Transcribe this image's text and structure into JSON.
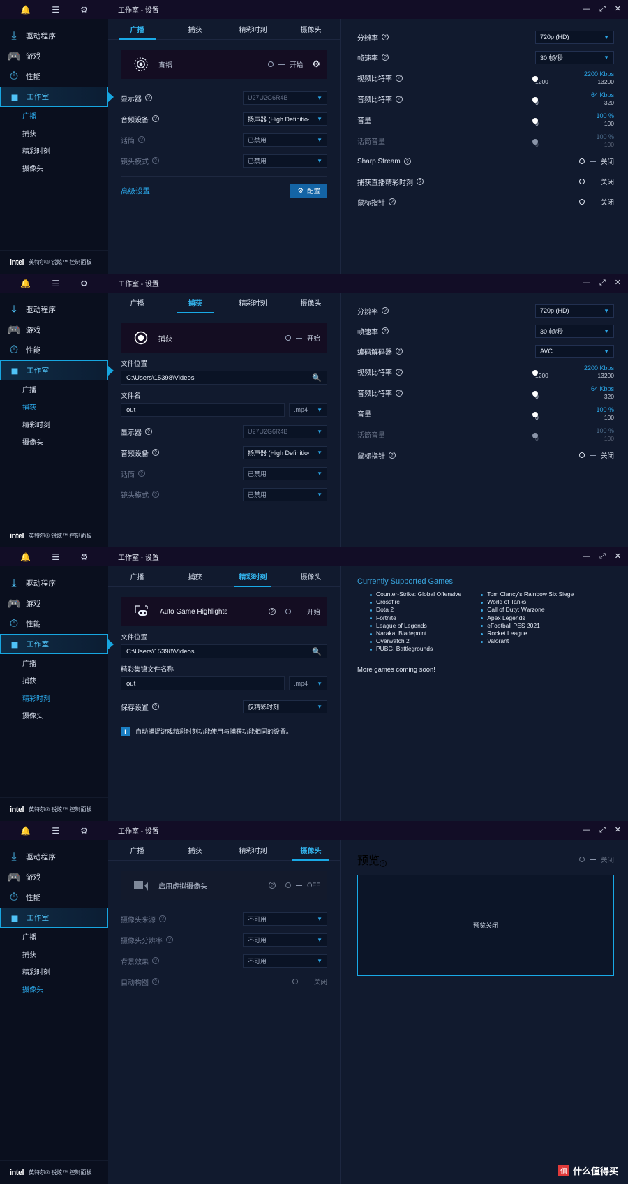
{
  "app": {
    "brand_logo": "intel",
    "brand_text": "英特尔® 锐炫™ 控制面板",
    "window_title": "工作室 - 设置",
    "min_label": "—",
    "max_label": "⤢",
    "close_label": "✕",
    "bell_icon": "bell-icon",
    "menu_icon": "menu-icon",
    "gear_icon": "gear-icon"
  },
  "sidebar": {
    "items": [
      {
        "label": "驱动程序",
        "icon": "download-icon"
      },
      {
        "label": "游戏",
        "icon": "gamepad-icon"
      },
      {
        "label": "性能",
        "icon": "gauge-icon"
      },
      {
        "label": "工作室",
        "icon": "camcorder-icon"
      }
    ],
    "sub_items": [
      {
        "label": "广播"
      },
      {
        "label": "捕获"
      },
      {
        "label": "精彩时刻"
      },
      {
        "label": "摄像头"
      }
    ]
  },
  "tabs": [
    {
      "label": "广播"
    },
    {
      "label": "捕获"
    },
    {
      "label": "精彩时刻"
    },
    {
      "label": "摄像头"
    }
  ],
  "common": {
    "start_label": "开始",
    "off_label": "关闭",
    "off_en_label": "OFF",
    "file_location_label": "文件位置",
    "file_location_value": "C:\\Users\\15398\\Videos",
    "search_icon": "search-icon",
    "filename_value": "out",
    "ext_value": ".mp4",
    "resolution_label": "分辨率",
    "resolution_value": "720p (HD)",
    "framerate_label": "帧速率",
    "framerate_value": "30 帧/秒",
    "video_bitrate_label": "视频比特率",
    "video_bitrate_value": "2200 Kbps",
    "video_bitrate_min": "1200",
    "video_bitrate_max": "13200",
    "audio_bitrate_label": "音频比特率",
    "audio_bitrate_value": "64 Kbps",
    "audio_bitrate_min": "0",
    "audio_bitrate_max": "320",
    "volume_label": "音量",
    "volume_value": "100 %",
    "volume_min": "0",
    "volume_max": "100",
    "mic_volume_label": "话筒音量",
    "mic_volume_value": "100 %",
    "mic_volume_min": "0",
    "mic_volume_max": "100",
    "mouse_pointer_label": "鼠标指针",
    "display_label": "显示器",
    "display_value": "U27U2G6R4B",
    "audio_device_label": "音频设备",
    "audio_device_value": "扬声器 (High Definitio⋯",
    "mic_label": "话筒",
    "mic_value": "已禁用",
    "lens_mode_label": "镜头模式",
    "lens_mode_value": "已禁用"
  },
  "panel_broadcast": {
    "hero_title": "直播",
    "hero_icon": "broadcast-icon",
    "gear_icon": "gear-icon",
    "advanced_label": "高级设置",
    "configure_label": "配置",
    "sharp_stream_label": "Sharp Stream",
    "capture_highlights_label": "捕获直播精彩时刻"
  },
  "panel_capture": {
    "hero_title": "捕获",
    "hero_icon": "record-icon",
    "filename_label": "文件名",
    "codec_label": "编码解码器",
    "codec_value": "AVC"
  },
  "panel_highlights": {
    "hero_title": "Auto Game Highlights",
    "hero_icon": "game-highlights-icon",
    "filename_label": "精彩集锦文件名称",
    "save_settings_label": "保存设置",
    "save_settings_value": "仅精彩时刻",
    "info_icon": "info-icon",
    "info_text": "自动捕捉游戏精彩时刻功能使用与捕获功能相同的设置。",
    "games_heading": "Currently Supported Games",
    "games_col1": [
      "Counter-Strike: Global Offensive",
      "Crossfire",
      "Dota 2",
      "Fortnite",
      "League of Legends",
      "Naraka: Bladepoint",
      "Overwatch 2",
      "PUBG: Battlegrounds"
    ],
    "games_col2": [
      "Tom Clancy's Rainbow Six Siege",
      "World of Tanks",
      "Call of Duty: Warzone",
      "Apex Legends",
      "eFootball PES 2021",
      "Rocket League",
      "Valorant"
    ],
    "more_games": "More games coming soon!"
  },
  "panel_camera": {
    "hero_title": "启用虚拟摄像头",
    "hero_icon": "webcam-icon",
    "camera_source_label": "摄像头来源",
    "camera_source_value": "不可用",
    "camera_resolution_label": "摄像头分辨率",
    "camera_resolution_value": "不可用",
    "background_effect_label": "背景效果",
    "background_effect_value": "不可用",
    "auto_framing_label": "自动构图",
    "preview_label": "预览",
    "preview_off_text": "预览关闭"
  },
  "watermark": {
    "badge": "值",
    "text": "什么值得买"
  },
  "colors": {
    "accent": "#19a9e6",
    "link": "#2ba7e8",
    "panel_bg": "#111a2e",
    "sidebar_bg": "#0a0f1e"
  }
}
